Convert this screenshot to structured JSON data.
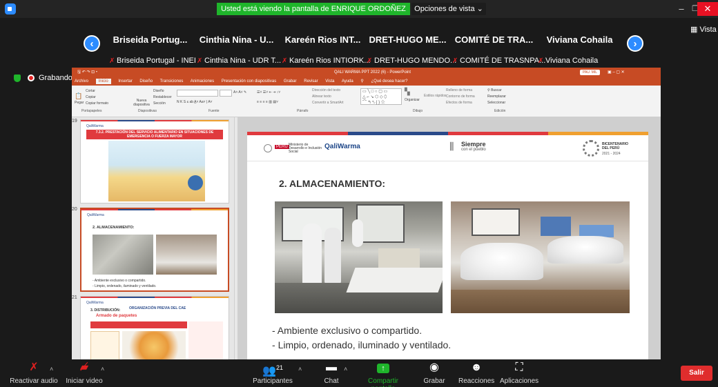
{
  "banner": {
    "sharing_text": "Usted está viendo la pantalla de ENRIQUE ORDOÑEZ LOPEZ",
    "view_options": "Opciones de vista ⌄"
  },
  "window_controls": {
    "minimize": "–",
    "restore": "❐",
    "close": "✕"
  },
  "participants_strip": {
    "view_label": "Vista",
    "tiles": [
      {
        "display": "Briseida Portug...",
        "full": "Briseida Portugal - INEI"
      },
      {
        "display": "Cinthia Nina - U...",
        "full": "Cinthia Nina - UDR T..."
      },
      {
        "display": "Kareén Rios INT...",
        "full": "Kareén Rios INTIORK..."
      },
      {
        "display": "DRET-HUGO ME...",
        "full": "DRET-HUGO MENDO..."
      },
      {
        "display": "COMITÉ DE TRA...",
        "full": "COMITÉ DE TRASNPA..."
      },
      {
        "display": "Viviana Cohaila",
        "full": "Viviana Cohaila"
      }
    ]
  },
  "recording": {
    "label": "Grabando"
  },
  "powerpoint": {
    "title": "QALI WARMA PPT 2022 (6)  -  PowerPoint",
    "user_badge": "PAU. MIL",
    "tabs": [
      "Archivo",
      "Inicio",
      "Insertar",
      "Diseño",
      "Transiciones",
      "Animaciones",
      "Presentación con diapositivas",
      "Grabar",
      "Revisar",
      "Vista",
      "Ayuda",
      "¿Qué desea hacer?"
    ],
    "ribbon_groups": [
      "Portapapeles",
      "Diapositivas",
      "Fuente",
      "Párrafo",
      "Dibujo",
      "Edición"
    ],
    "ribbon": {
      "pegar": "Pegar",
      "cortar": "Cortar",
      "copiar": "Copiar",
      "copiar_formato": "Copiar formato",
      "nueva": "Nueva diapositiva",
      "diseno": "Diseño",
      "restablecer": "Restablecer",
      "seccion": "Sección",
      "direccion": "Dirección del texto",
      "alinear": "Alinear texto",
      "smartart": "Convertir a SmartArt",
      "organizar": "Organizar",
      "estilos": "Estilos rápidos",
      "relleno": "Relleno de forma",
      "contorno": "Contorno de forma",
      "efectos": "Efectos de forma",
      "buscar": "Buscar",
      "reemplazar": "Reemplazar",
      "seleccionar": "Seleccionar"
    }
  },
  "thumbnails": [
    {
      "number": "19",
      "title": "7.3.2. PRESTACIÓN DEL SERVICIO ALIMENTARIO EN SITUACIONES DE EMERGENCIA O FUERZA MAYOR"
    },
    {
      "number": "20",
      "title": "2. ALMACENAMIENTO:",
      "bullets": [
        "Ambiente exclusivo o compartido.",
        "Limpio, ordenado, iluminado y ventilado."
      ]
    },
    {
      "number": "21",
      "title": "ORGANIZACIÓN PREVIA DEL CAE",
      "sub1": "3. DISTRIBUCIÓN:",
      "sub2": "Armado de paquetes"
    }
  ],
  "slide": {
    "heading": "2. ALMACENAMIENTO:",
    "bullets": [
      "Ambiente exclusivo o compartido.",
      "Limpio, ordenado, iluminado y ventilado."
    ],
    "logos": {
      "peru": "PERÚ",
      "ministry": "Ministerio de Desarrollo e Inclusión Social",
      "qaliwarma": "QaliWarma",
      "siempre": "Siempre",
      "con_el_pueblo": "con el pueblo",
      "bicentenario": "BICENTENARIO DEL PERÚ",
      "years": "2021 - 2024"
    },
    "bar_colors": [
      "#e03a3e",
      "#2a4a8a",
      "#e03a3e",
      "#f0a030"
    ]
  },
  "toolbar": {
    "audio": "Reactivar audio",
    "video": "Iniciar video",
    "participants": "Participantes",
    "participants_count": "21",
    "chat": "Chat",
    "share": "Compartir pantalla",
    "record": "Grabar",
    "reactions": "Reacciones",
    "apps": "Aplicaciones",
    "leave": "Salir"
  }
}
